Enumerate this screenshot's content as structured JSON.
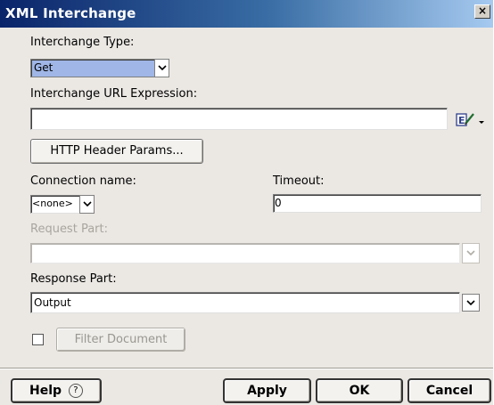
{
  "dialog": {
    "title": "XML Interchange",
    "close_glyph": "×"
  },
  "interchange_type": {
    "label": "Interchange Type:",
    "value": "Get"
  },
  "url_expression": {
    "label": "Interchange URL Expression:",
    "value": ""
  },
  "http_header_button": "HTTP Header Params...",
  "connection": {
    "label": "Connection name:",
    "value": "<none>"
  },
  "timeout": {
    "label": "Timeout:",
    "value": "0"
  },
  "request_part": {
    "label": "Request Part:",
    "value": "",
    "enabled": false
  },
  "response_part": {
    "label": "Response Part:",
    "value": "Output"
  },
  "filter_document": {
    "checked": false,
    "button_label": "Filter Document"
  },
  "footer": {
    "help_label": "Help",
    "help_icon": "?",
    "apply_label": "Apply",
    "ok_label": "OK",
    "cancel_label": "Cancel"
  }
}
